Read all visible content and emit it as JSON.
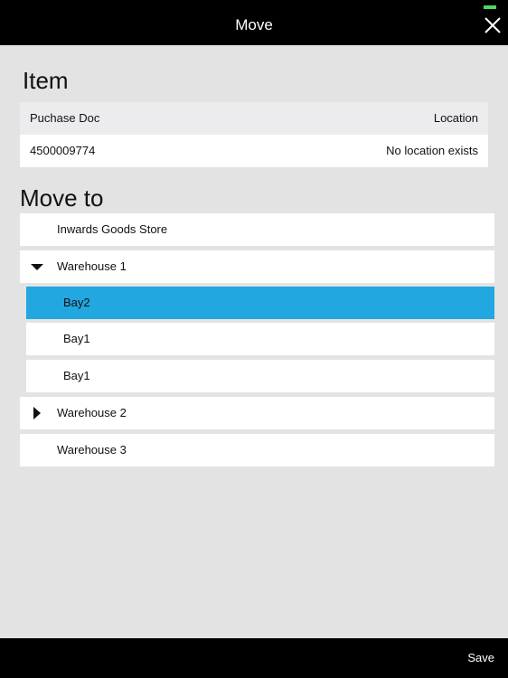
{
  "header": {
    "title": "Move"
  },
  "item_section": {
    "title": "Item",
    "columns": [
      "Puchase Doc",
      "Location"
    ],
    "row": {
      "purchase_doc": "4500009774",
      "location": "No location exists"
    }
  },
  "move_to": {
    "title": "Move to",
    "items": [
      {
        "label": "Inwards Goods Store"
      },
      {
        "label": "Warehouse 1",
        "expanded": true
      },
      {
        "label": "Bay2",
        "selected": true
      },
      {
        "label": "Bay1"
      },
      {
        "label": "Bay1"
      },
      {
        "label": "Warehouse 2",
        "expanded": false
      },
      {
        "label": "Warehouse 3"
      }
    ]
  },
  "footer": {
    "save_label": "Save"
  },
  "colors": {
    "bar": "#000000",
    "background": "#e3e3e3",
    "selected": "#22a7e0",
    "battery": "#4cd964"
  },
  "icons": {
    "close": "close-icon",
    "expand": "triangle-down-icon",
    "collapse": "triangle-right-icon"
  }
}
